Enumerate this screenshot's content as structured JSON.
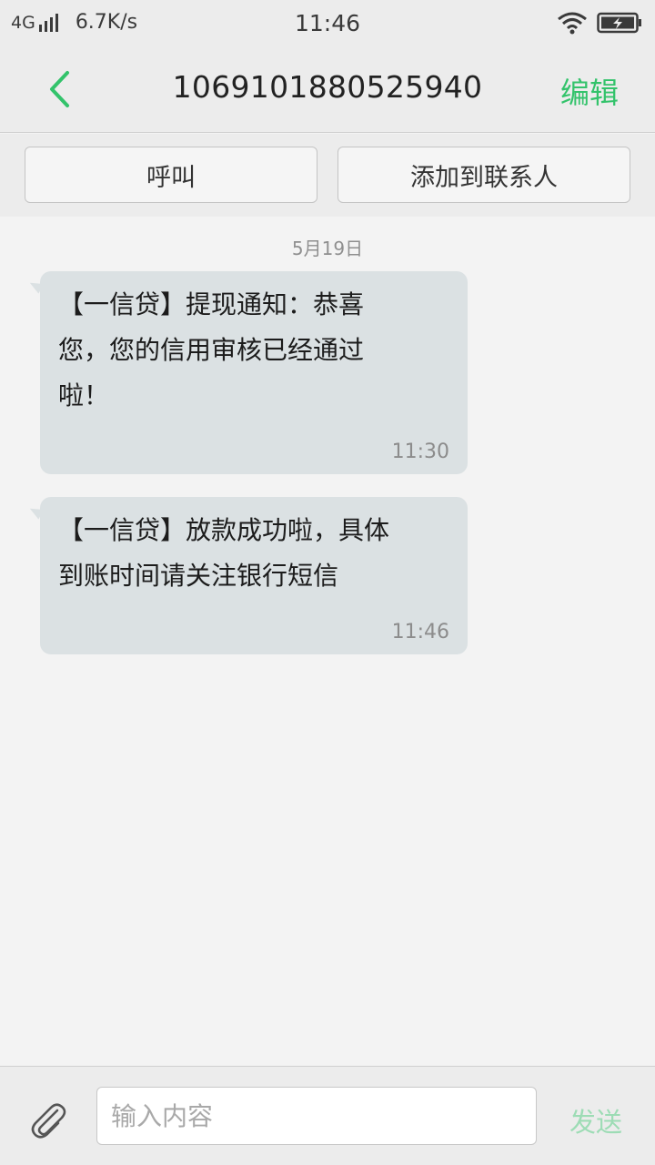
{
  "status_bar": {
    "network": "4G",
    "speed": "6.7K/s",
    "time": "11:46",
    "icons": [
      "signal-icon",
      "wifi-icon",
      "battery-charging-icon"
    ]
  },
  "header": {
    "title": "1069101880525940",
    "edit_label": "编辑",
    "back_icon": "chevron-left-icon"
  },
  "actions": {
    "call_label": "呼叫",
    "add_contact_label": "添加到联系人"
  },
  "thread": {
    "date": "5月19日",
    "messages": [
      {
        "lines": [
          "【一信贷】提现通知：恭喜",
          "您，您的信用审核已经通过",
          "啦！"
        ],
        "time": "11:30"
      },
      {
        "lines": [
          "【一信贷】放款成功啦，具体",
          "到账时间请关注银行短信"
        ],
        "time": "11:46"
      }
    ]
  },
  "composer": {
    "placeholder": "输入内容",
    "value": "",
    "send_label": "发送",
    "attach_icon": "paperclip-icon"
  },
  "colors": {
    "accent": "#33c36b",
    "send_disabled": "#9ddcb5",
    "bubble": "#dbe1e3",
    "background": "#f3f3f3",
    "bar": "#ececec"
  }
}
